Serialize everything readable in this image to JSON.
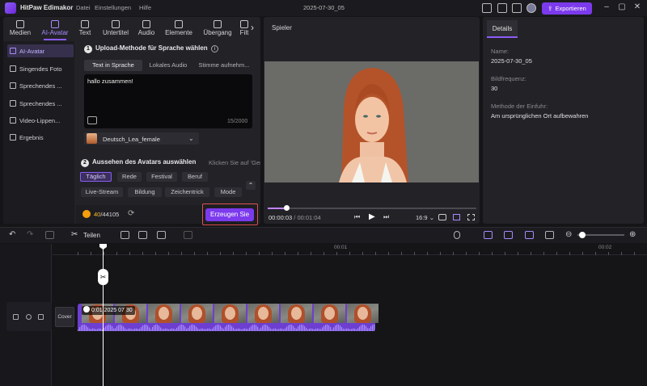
{
  "app": {
    "name": "HitPaw Edimakor",
    "menu": [
      "Datei",
      "Einstellungen",
      "Hilfe"
    ],
    "project_title": "2025-07-30_05",
    "export_label": "Exportieren"
  },
  "tabs": [
    {
      "label": "Medien",
      "icon": "media-icon"
    },
    {
      "label": "AI-Avatar",
      "icon": "ai-avatar-icon"
    },
    {
      "label": "Text",
      "icon": "text-icon"
    },
    {
      "label": "Untertitel",
      "icon": "subtitle-icon"
    },
    {
      "label": "Audio",
      "icon": "audio-icon"
    },
    {
      "label": "Elemente",
      "icon": "elements-icon"
    },
    {
      "label": "Übergang",
      "icon": "transition-icon"
    },
    {
      "label": "Filt",
      "icon": "filter-icon"
    }
  ],
  "sidebar": {
    "items": [
      {
        "label": "AI-Avatar",
        "active": true
      },
      {
        "label": "Singendes Foto"
      },
      {
        "label": "Sprechendes ..."
      },
      {
        "label": "Sprechendes ..."
      },
      {
        "label": "Video-Lippen..."
      },
      {
        "label": "Ergebnis"
      }
    ]
  },
  "upload": {
    "title": "Upload-Methode für Sprache wählen",
    "step": "1",
    "tabs": [
      "Text in Sprache",
      "Lokales Audio",
      "Stimme aufnehm..."
    ],
    "text_value": "hallo zusammen!",
    "counter": "15/2000",
    "voice": "Deutsch_Lea_female"
  },
  "appearance": {
    "step": "2",
    "title": "Aussehen des Avatars auswählen",
    "hint": "Klicken Sie auf 'Generi",
    "chips": [
      "Täglich",
      "Rede",
      "Festival",
      "Beruf",
      "Live-Stream",
      "Bildung",
      "Zeichentrick",
      "Mode"
    ]
  },
  "footer": {
    "credits_used": "40",
    "credits_total": "/44105",
    "generate_label": "Erzeugen Sie"
  },
  "player": {
    "title": "Spieler",
    "current_time": "00:00:03",
    "duration": "/ 00:01:04",
    "aspect": "16:9",
    "progress": 0.08
  },
  "details": {
    "tab": "Details",
    "name_label": "Name:",
    "name_value": "2025-07-30_05",
    "fps_label": "Bildfrequenz:",
    "fps_value": "30",
    "method_label": "Methode der Einfuhr:",
    "method_value": "Am ursprünglichen Ort aufbewahren"
  },
  "timeline": {
    "split_label": "Teilen",
    "ruler_labels": [
      "00:01",
      "00:02"
    ],
    "cover_label": "Cover",
    "clip_label": "0:01 2025 07 30",
    "zoom_level": 0.05
  }
}
